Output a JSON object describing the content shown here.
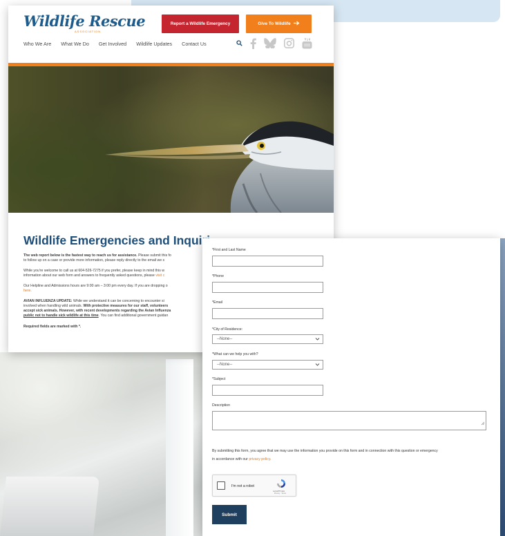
{
  "site": {
    "logo": "Wildlife Rescue",
    "logo_sub": "ASSOCIATION",
    "buttons": {
      "report": "Report a Wildlife Emergency",
      "give": "Give To Wildlife"
    },
    "nav": [
      "Who We Are",
      "What We Do",
      "Get Involved",
      "Wildlife Updates",
      "Contact Us"
    ],
    "icons": [
      "search-icon",
      "facebook-icon",
      "bluesky-icon",
      "instagram-icon",
      "youtube-icon"
    ],
    "accent_color": "#f07f1c",
    "report_color": "#c4252f",
    "title_color": "#1d4e79"
  },
  "page": {
    "title": "Wildlife Emergencies and Inquiri",
    "p1_bold": "The web report below is the fastest way to reach us for assistance.",
    "p1_rest": " Please submit this fo",
    "p1_line2": "to follow up on a case or provide more information, please reply directly to the email we s",
    "p2_line1": "While you're welcome to call us at 604-526-7275 if you prefer, please keep in mind this w",
    "p2_line2": "information about our web form and answers to frequently asked questions, please ",
    "p2_link": "visit c",
    "p3_line1": "Our Helpline and Admissions hours are 9:00 am – 3:00 pm every day. If you are dropping o",
    "p3_link": "here.",
    "p4_bold_lead": "AVIAN INFLUENZA UPDATE:",
    "p4_line1": " While we understand it can be concerning to encounter si",
    "p4_line2a": "involved when handling wild animals. ",
    "p4_line2b": "With protective measures for our staff, volunteers",
    "p4_line3": "accept sick animals. However, with recent developments regarding the Avian Influenza",
    "p4_line4_underline": "public not to handle sick wildlife at this time",
    "p4_line4_rest": ". You can find additional government guidan",
    "required_note": "Required fields are marked with *."
  },
  "form": {
    "fields": {
      "name_label": "*First and Last Name",
      "phone_label": "*Phone",
      "email_label": "*Email",
      "city_label": "*City of Residence:",
      "city_value": "--None--",
      "help_label": "*What can we help you with?",
      "help_value": "--None--",
      "subject_label": "*Subject",
      "description_label": "Description"
    },
    "consent_line1": "By submitting this form, you agree that we may use the information you provide on this form and in connection with this question or emergency",
    "consent_line2": "in accordance with our ",
    "privacy_link": "privacy policy",
    "consent_end": ".",
    "captcha_label": "I'm not a robot",
    "captcha_brand": "reCAPTCHA",
    "captcha_terms": "Privacy - Terms",
    "submit_label": "Submit",
    "submit_color": "#1f3f5f"
  }
}
